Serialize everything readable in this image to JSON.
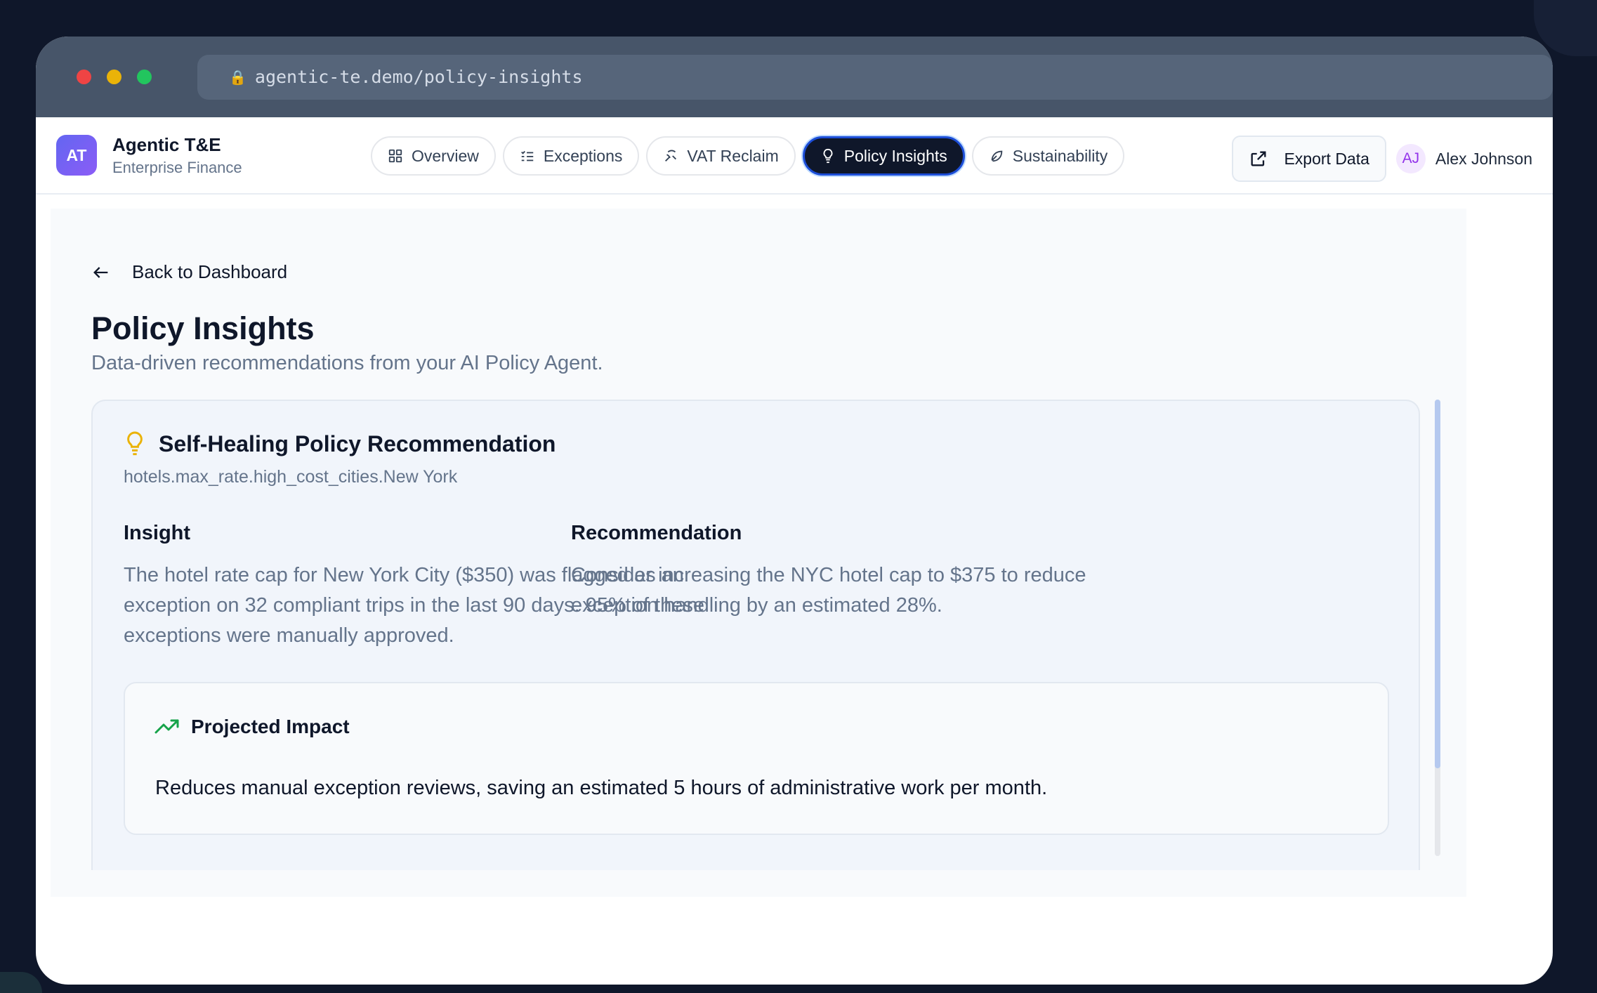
{
  "browser": {
    "url": "agentic-te.demo/policy-insights"
  },
  "brand": {
    "logo": "AT",
    "name": "Agentic T&E",
    "subtitle": "Enterprise Finance"
  },
  "nav": {
    "tabs": [
      {
        "label": "Overview",
        "icon": "grid-icon"
      },
      {
        "label": "Exceptions",
        "icon": "list-check-icon"
      },
      {
        "label": "VAT Reclaim",
        "icon": "receipt-icon"
      },
      {
        "label": "Policy Insights",
        "icon": "lightbulb-icon",
        "active": true
      },
      {
        "label": "Sustainability",
        "icon": "leaf-icon"
      }
    ]
  },
  "actions": {
    "export_label": "Export Data",
    "user_initials": "AJ",
    "user_name": "Alex Johnson"
  },
  "page": {
    "back_label": "Back to Dashboard",
    "title": "Policy Insights",
    "subtitle": "Data-driven recommendations from your AI Policy Agent."
  },
  "card": {
    "title": "Self-Healing Policy Recommendation",
    "policy_path": "hotels.max_rate.high_cost_cities.New York",
    "insight_heading": "Insight",
    "insight_text": "The hotel rate cap for New York City ($350) was flagged as an exception on 32 compliant trips in the last 90 days. 95% of these exceptions were manually approved.",
    "recommendation_heading": "Recommendation",
    "recommendation_text": "Consider increasing the NYC hotel cap to $375 to reduce exception handling by an estimated 28%.",
    "impact_title": "Projected Impact",
    "impact_text": "Reduces manual exception reviews, saving an estimated 5 hours of administrative work per month."
  },
  "colors": {
    "traffic_red": "#ef4444",
    "traffic_yellow": "#eab308",
    "traffic_green": "#22c55e",
    "accent_active": "#0f172a",
    "bulb": "#eab308",
    "trend": "#16a34a"
  }
}
